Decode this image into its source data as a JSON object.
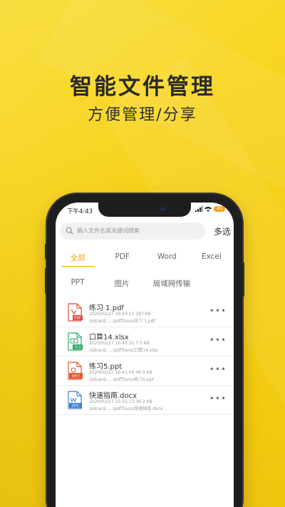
{
  "promo": {
    "headline": "智能文件管理",
    "subline": "方便管理/分享"
  },
  "status_bar": {
    "time": "下午4:43",
    "battery": "45"
  },
  "search": {
    "placeholder": "输入文件名或关键词搜索",
    "multi_select_label": "多选"
  },
  "tabs": {
    "row1": [
      "全部",
      "PDF",
      "Word",
      "Excel"
    ],
    "row2": [
      "PPT",
      "图片",
      "局域网传输"
    ],
    "active": "全部"
  },
  "files": [
    {
      "name": "练习 1.pdf",
      "meta": "2020/02/27 16:43:11  187 KB",
      "path": "/sdcard/...../pdfTrans/练习 1.pdf",
      "icon": "pdf-file-icon",
      "badge": "PDF",
      "color": "#e04b3f"
    },
    {
      "name": "口算14.xlsx",
      "meta": "2020/02/27 16:42:31  7.5 KB",
      "path": "/sdcard/...../pdfTrans/口算14.xlsx",
      "icon": "excel-file-icon",
      "badge": "XLS",
      "color": "#2fa866"
    },
    {
      "name": "练习5.ppt",
      "meta": "2020/02/27 16:41:56  46.5 KB",
      "path": "/sdcard/...../pdfTrans/练习5.ppt",
      "icon": "ppt-file-icon",
      "badge": "PPT",
      "color": "#e05a30"
    },
    {
      "name": "快速指南.docx",
      "meta": "2020/02/27 15:55:13  39.2 KB",
      "path": "/sdcard/...../pdfTrans/快速指南.docx",
      "icon": "word-file-icon",
      "badge": "DOC",
      "color": "#3b7fd6"
    }
  ],
  "more_glyph": "•••",
  "colors": {
    "background": "#f7d21a",
    "accent": "#f0a818"
  }
}
